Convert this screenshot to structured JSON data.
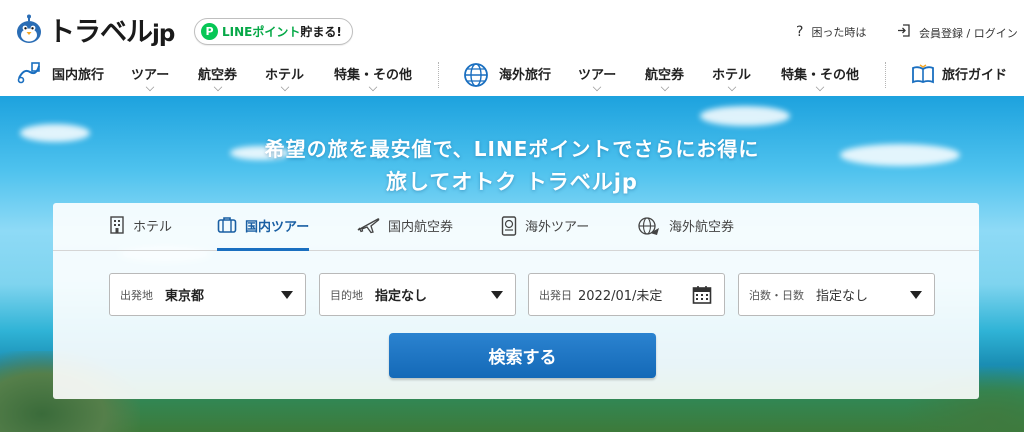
{
  "header": {
    "logo_text": "トラベル",
    "logo_suffix": "jp",
    "line_badge": {
      "icon_letter": "P",
      "brand": "LINEポイント",
      "suffix": "貯まる!"
    },
    "help_link": "困った時は",
    "login_link": "会員登録 / ログイン"
  },
  "nav": {
    "domestic": {
      "label": "国内旅行",
      "items": [
        "ツアー",
        "航空券",
        "ホテル",
        "特集・その他"
      ]
    },
    "overseas": {
      "label": "海外旅行",
      "items": [
        "ツアー",
        "航空券",
        "ホテル",
        "特集・その他"
      ]
    },
    "guide": {
      "label": "旅行ガイド"
    }
  },
  "hero": {
    "title_line1": "希望の旅を最安値で、LINEポイントでさらにお得に",
    "title_line2": "旅してオトク トラベルjp"
  },
  "search": {
    "tabs": [
      {
        "label": "ホテル",
        "icon": "hotel-icon"
      },
      {
        "label": "国内ツアー",
        "icon": "suitcase-icon",
        "active": true
      },
      {
        "label": "国内航空券",
        "icon": "airplane-icon"
      },
      {
        "label": "海外ツアー",
        "icon": "passport-icon"
      },
      {
        "label": "海外航空券",
        "icon": "globe-airplane-icon"
      }
    ],
    "fields": {
      "departure": {
        "label": "出発地",
        "value": "東京都"
      },
      "destination": {
        "label": "目的地",
        "value": "指定なし"
      },
      "date": {
        "label": "出発日",
        "value": "2022/01/未定"
      },
      "nights": {
        "label": "泊数・日数",
        "value": "指定なし"
      }
    },
    "submit_label": "検索する"
  },
  "colors": {
    "brand_blue": "#1469b7",
    "line_green": "#06c755",
    "active_tab": "#1a5fa3"
  }
}
